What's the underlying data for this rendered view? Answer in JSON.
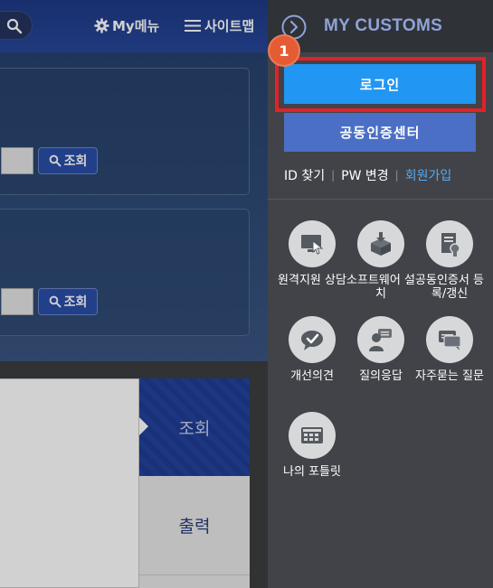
{
  "header": {
    "my_menu_label": "My메뉴",
    "sitemap_label": "사이트맵"
  },
  "left_panel": {
    "search_button_label": "조회",
    "search_button_label_2": "조회",
    "tab_view_label": "조회",
    "tab_print_label": "출력"
  },
  "drawer": {
    "title": "MY CUSTOMS",
    "step_number": "1",
    "login_label": "로그인",
    "cert_center_label": "공동인증센터",
    "links": {
      "find_id": "ID 찾기",
      "change_pw": "PW 변경",
      "signup": "회원가입"
    },
    "services": [
      {
        "icon": "remote-support-icon",
        "label": "원격지원 상담"
      },
      {
        "icon": "software-install-icon",
        "label": "소프트웨어 설치"
      },
      {
        "icon": "certificate-icon",
        "label": "공동인증서 등록/갱신"
      },
      {
        "icon": "feedback-icon",
        "label": "개선의견"
      },
      {
        "icon": "qna-icon",
        "label": "질의응답"
      },
      {
        "icon": "faq-icon",
        "label": "자주묻는 질문"
      },
      {
        "icon": "portlet-icon",
        "label": "나의 포틀릿"
      }
    ]
  },
  "colors": {
    "highlight_border": "#e32227",
    "login_button": "#2196f3",
    "cert_button": "#4a6fc4",
    "step_badge": "#e55c34",
    "signup_link": "#55aaf5"
  }
}
